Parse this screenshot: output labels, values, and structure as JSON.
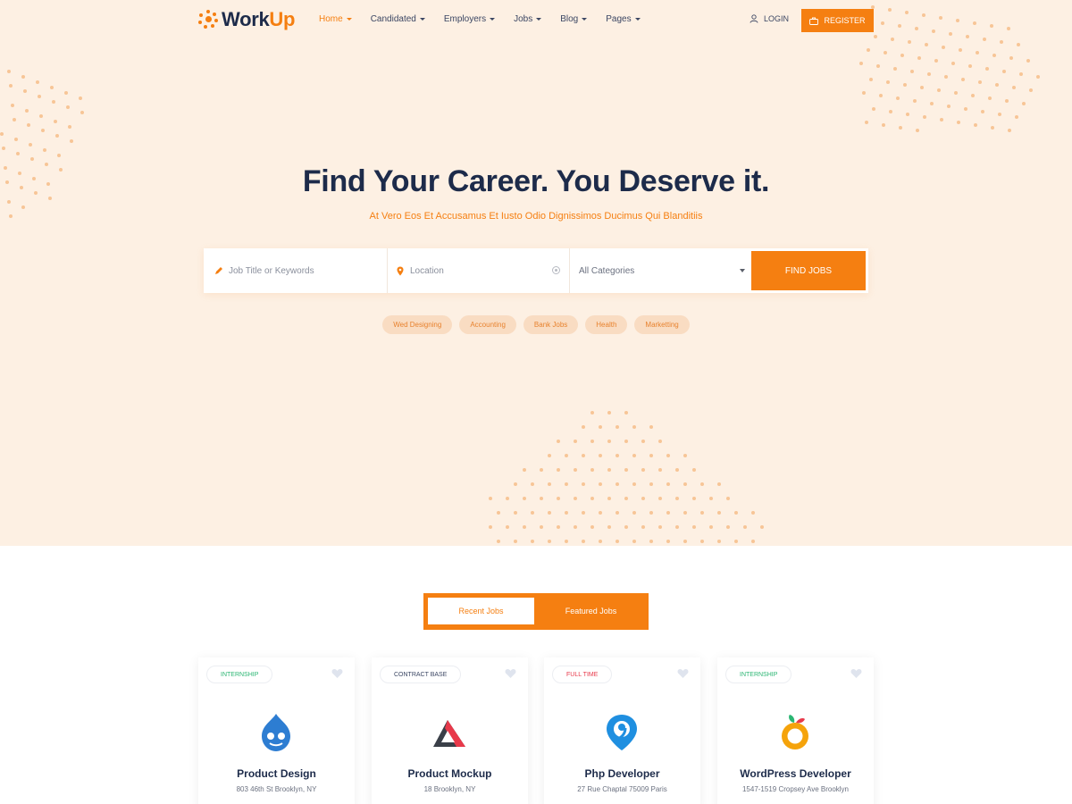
{
  "brand": {
    "logo_work": "Work",
    "logo_up": "Up",
    "accent": "#f57f11",
    "navy": "#1d2b4a"
  },
  "nav": {
    "items": [
      {
        "label": "Home",
        "active": true
      },
      {
        "label": "Candidated"
      },
      {
        "label": "Employers"
      },
      {
        "label": "Jobs"
      },
      {
        "label": "Blog"
      },
      {
        "label": "Pages"
      }
    ],
    "login": "LOGIN",
    "register": "REGISTER"
  },
  "hero": {
    "title": "Find Your Career. You Deserve it.",
    "subtitle": "At Vero Eos Et Accusamus Et Iusto Odio Dignissimos Ducimus Qui Blanditiis"
  },
  "search": {
    "keyword_placeholder": "Job Title or Keywords",
    "location_placeholder": "Location",
    "category_value": "All Categories",
    "button": "FIND JOBS"
  },
  "tags": [
    "Wed Designing",
    "Accounting",
    "Bank Jobs",
    "Health",
    "Marketting"
  ],
  "tabs": {
    "recent": "Recent Jobs",
    "featured": "Featured Jobs"
  },
  "jobs": [
    {
      "badge": "INTERNSHIP",
      "badge_color": "#2bb673",
      "title": "Product Design",
      "location": "803 46th St Brooklyn, NY",
      "logo": "drupal-logo"
    },
    {
      "badge": "CONTRACT BASE",
      "badge_color": "#3b4663",
      "title": "Product Mockup",
      "location": "18 Brooklyn, NY",
      "logo": "triangle-logo"
    },
    {
      "badge": "FULL TIME",
      "badge_color": "#e8394a",
      "title": "Php Developer",
      "location": "27 Rue Chaptal 75009 Paris",
      "logo": "map-pin-logo"
    },
    {
      "badge": "INTERNSHIP",
      "badge_color": "#2bb673",
      "title": "WordPress Developer",
      "location": "1547-1519 Cropsey Ave Brooklyn",
      "logo": "orange-logo"
    }
  ]
}
